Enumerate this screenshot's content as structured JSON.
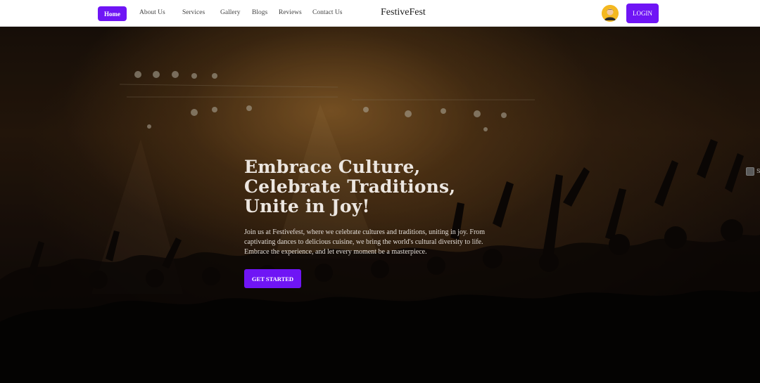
{
  "nav": {
    "home": "Home",
    "links": [
      "About Us",
      "Services",
      "Gallery",
      "Blogs",
      "Reviews",
      "Contact Us"
    ],
    "brand": "FestiveFest",
    "login": "LOGIN",
    "accent": "#6f15f5"
  },
  "hero": {
    "title_lines": [
      "Embrace Culture,",
      "Celebrate Traditions,",
      "Unite in Joy!"
    ],
    "description": "Join us at Festivefest, where we celebrate cultures and traditions, uniting in joy. From captivating dances to delicious cuisine, we bring the world's cultural diversity to life. Embrace the experience, and let every moment be a masterpiece.",
    "cta": "GET STARTED",
    "side_letter": "S"
  },
  "icons": {
    "avatar": "user-avatar-icon",
    "side_widget": "widget-toggle-icon"
  }
}
